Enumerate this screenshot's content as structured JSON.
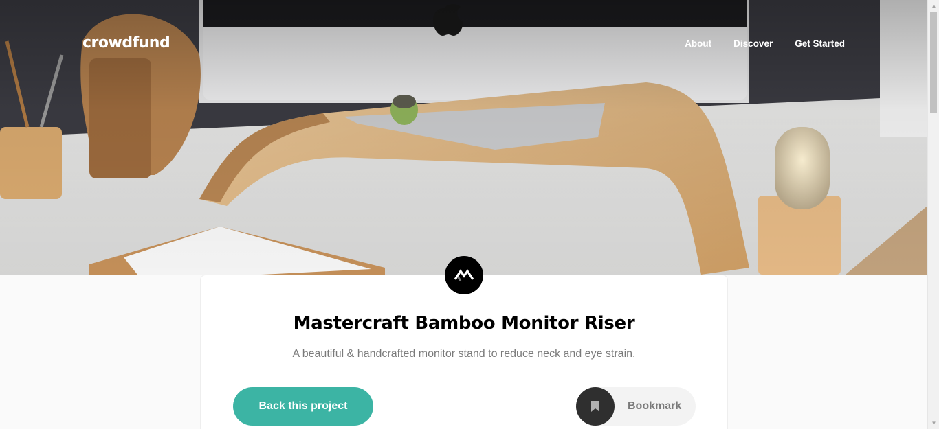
{
  "header": {
    "logo": "crowdfund",
    "nav": [
      {
        "label": "About"
      },
      {
        "label": "Discover"
      },
      {
        "label": "Get Started"
      }
    ]
  },
  "hero": {
    "image": "desk-with-monitor-on-bamboo-riser"
  },
  "project": {
    "badge_icon": "mastercraft-logo-icon",
    "title": "Mastercraft Bamboo Monitor Riser",
    "subtitle": "A beautiful & handcrafted monitor stand to reduce neck and eye strain.",
    "back_label": "Back this project",
    "bookmark_label": "Bookmark"
  },
  "colors": {
    "accent": "#3cb4a4",
    "dark": "#2f2f2f",
    "text_muted": "#7a7a7a"
  }
}
